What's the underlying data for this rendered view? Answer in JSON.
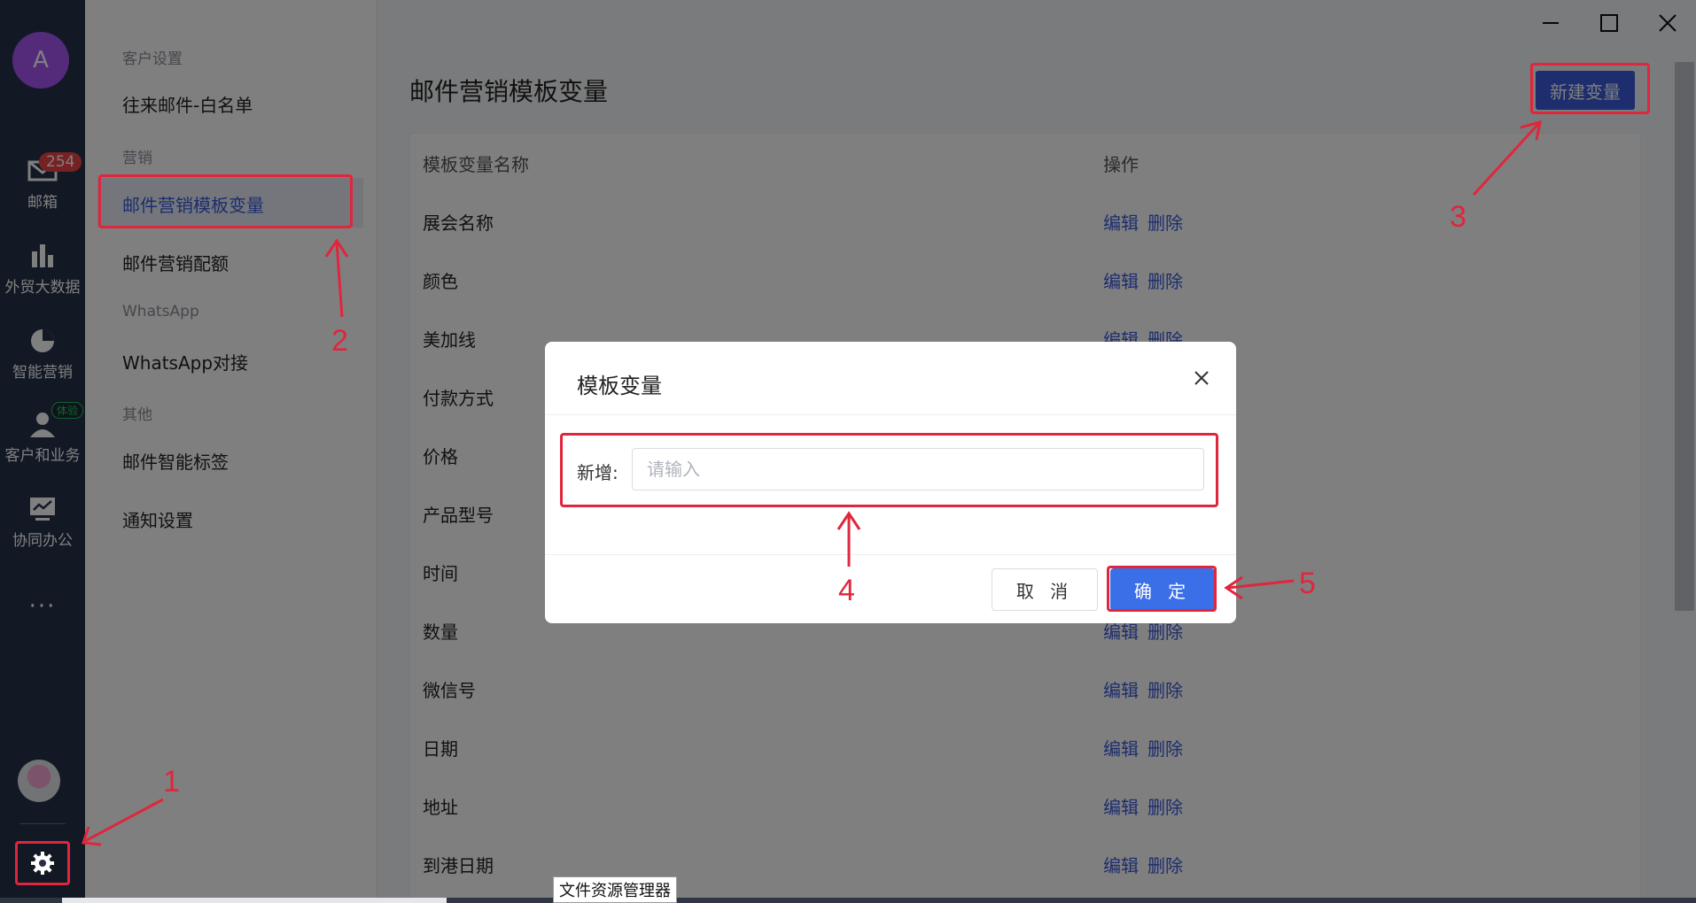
{
  "rail": {
    "avatar_letter": "A",
    "mail_label": "邮箱",
    "mail_badge": "254",
    "bigdata_label": "外贸大数据",
    "marketing_label": "智能营销",
    "customer_label": "客户和业务",
    "customer_badge": "体验",
    "collab_label": "协同办公",
    "more": "···"
  },
  "sidebar": {
    "group_customer": "客户设置",
    "item_whitelist": "往来邮件-白名单",
    "group_marketing": "营销",
    "item_template_vars": "邮件营销模板变量",
    "item_quota": "邮件营销配额",
    "group_whatsapp": "WhatsApp",
    "item_whatsapp": "WhatsApp对接",
    "group_other": "其他",
    "item_tags": "邮件智能标签",
    "item_notify": "通知设置"
  },
  "main": {
    "title": "邮件营销模板变量",
    "new_button": "新建变量",
    "table": {
      "col_name": "模板变量名称",
      "col_action": "操作",
      "edit": "编辑",
      "delete": "删除",
      "rows": [
        "展会名称",
        "颜色",
        "美加线",
        "付款方式",
        "价格",
        "产品型号",
        "时间",
        "数量",
        "微信号",
        "日期",
        "地址",
        "到港日期"
      ]
    }
  },
  "dialog": {
    "title": "模板变量",
    "field_label": "新增:",
    "field_placeholder": "请输入",
    "cancel": "取 消",
    "ok": "确 定"
  },
  "annotations": [
    "1",
    "2",
    "3",
    "4",
    "5"
  ],
  "taskbar": {
    "tooltip": "文件资源管理器"
  },
  "colors": {
    "accent": "#3b5bdb",
    "annotation_red": "#e0263c",
    "rail_bg": "#243049"
  }
}
